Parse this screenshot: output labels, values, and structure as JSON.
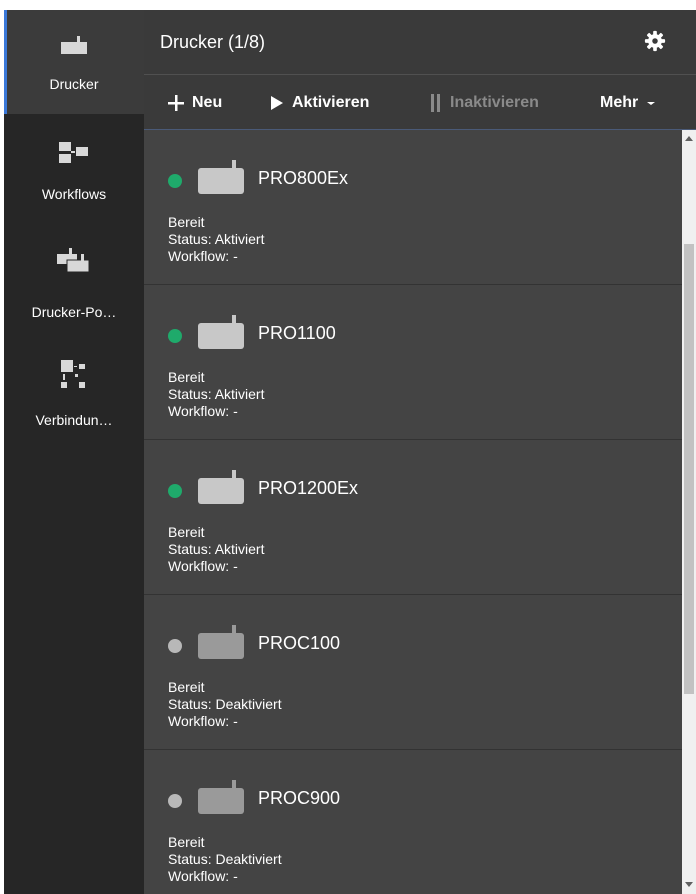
{
  "nav": {
    "items": [
      {
        "label": "Drucker",
        "icon": "printer-icon",
        "active": true
      },
      {
        "label": "Workflows",
        "icon": "workflow-icon",
        "active": false
      },
      {
        "label": "Drucker-Po…",
        "icon": "printer-pool-icon",
        "active": false
      },
      {
        "label": "Verbindun…",
        "icon": "connection-icon",
        "active": false
      }
    ]
  },
  "header": {
    "title": "Drucker (1/8)",
    "settings_icon": "gear-icon"
  },
  "toolbar": {
    "new_label": "Neu",
    "activate_label": "Aktivieren",
    "deactivate_label": "Inaktivieren",
    "more_label": "Mehr"
  },
  "printers": [
    {
      "name": "PRO800Ex",
      "state": "Bereit",
      "status": "Status: Aktiviert",
      "workflow": "Workflow: -",
      "active": true
    },
    {
      "name": "PRO1100",
      "state": "Bereit",
      "status": "Status: Aktiviert",
      "workflow": "Workflow: -",
      "active": true
    },
    {
      "name": "PRO1200Ex",
      "state": "Bereit",
      "status": "Status: Aktiviert",
      "workflow": "Workflow: -",
      "active": true
    },
    {
      "name": "PROC100",
      "state": "Bereit",
      "status": "Status: Deaktiviert",
      "workflow": "Workflow: -",
      "active": false
    },
    {
      "name": "PROC900",
      "state": "Bereit",
      "status": "Status: Deaktiviert",
      "workflow": "Workflow: -",
      "active": false
    }
  ],
  "colors": {
    "accent": "#3a78d8",
    "active_dot": "#1faa6b",
    "inactive_dot": "#b8b8b8"
  }
}
